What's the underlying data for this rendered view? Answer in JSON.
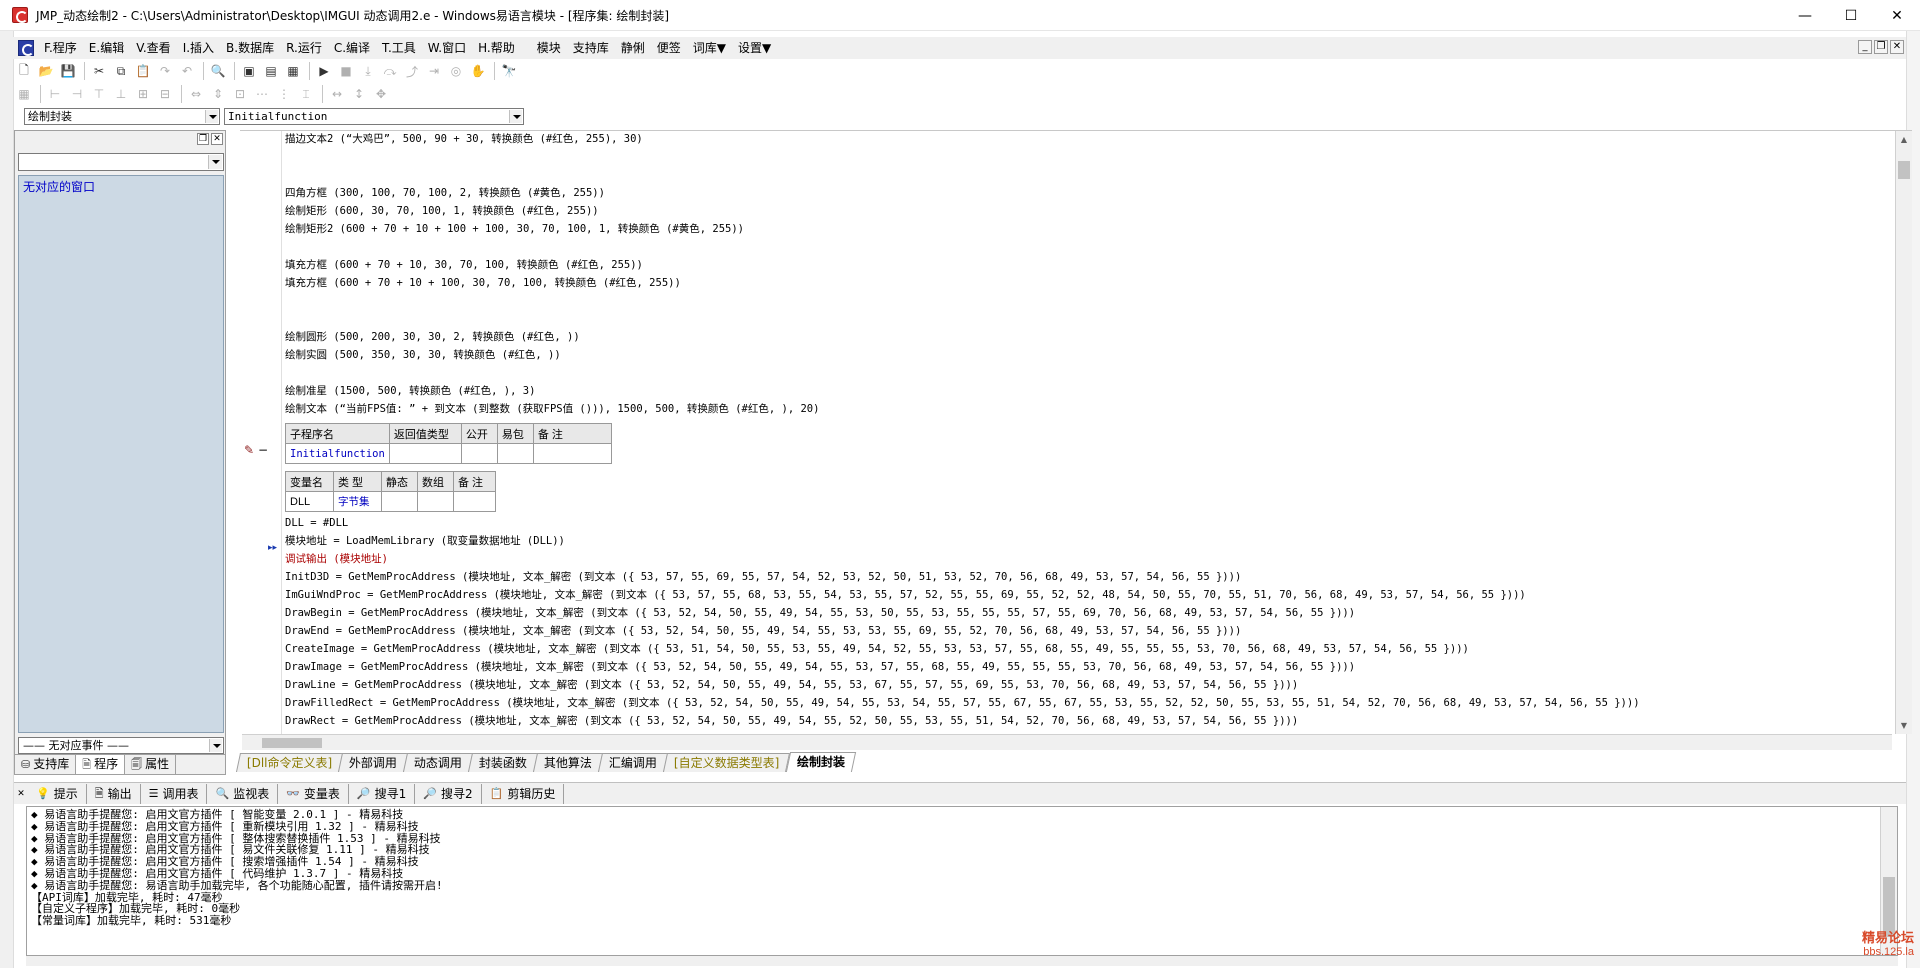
{
  "window": {
    "title": "JMP_动态绘制2 - C:\\Users\\Administrator\\Desktop\\IMGUI 动态调用2.e - Windows易语言模块 - [程序集: 绘制封装]",
    "minimize": "—",
    "maximize": "☐",
    "close": "✕"
  },
  "menu": {
    "items": [
      "F.程序",
      "E.编辑",
      "V.查看",
      "I.插入",
      "B.数据库",
      "R.运行",
      "C.编译",
      "T.工具",
      "W.窗口",
      "H.帮助",
      "模块",
      "支持库",
      "静俐",
      "便签",
      "词库▼",
      "设置▼"
    ],
    "mdi_min": "_",
    "mdi_restore": "❐",
    "mdi_close": "✕"
  },
  "combos": {
    "module": "绘制封装",
    "sub": "Initialfunction"
  },
  "left_panel": {
    "list_item": "无对应的窗口",
    "event_combo": "—— 无对应事件 ——",
    "tabs": [
      "支持库",
      "程序",
      "属性"
    ]
  },
  "code_lines": [
    "描边文本2 (“大鸡巴”, 500, 90 + 30, 转换颜色 (#红色, 255), 30)",
    "四角方框 (300, 100, 70, 100, 2, 转换颜色 (#黄色, 255))",
    "绘制矩形 (600, 30, 70, 100, 1, 转换颜色 (#红色, 255))",
    "绘制矩形2 (600 + 70 + 10 + 100 + 100, 30, 70, 100, 1, 转换颜色 (#黄色, 255))",
    "填充方框 (600 + 70 + 10, 30, 70, 100, 转换颜色 (#红色, 255))",
    "填充方框 (600 + 70 + 10 + 100, 30, 70, 100, 转换颜色 (#红色, 255))",
    "绘制圆形 (500, 200, 30, 30, 2, 转换颜色 (#红色, ))",
    "绘制实圆 (500, 350, 30, 30, 转换颜色 (#红色, ))",
    "绘制准星 (1500, 500, 转换颜色 (#红色, ), 3)",
    "绘制文本 (“当前FPS值: ” + 到文本 (到整数 (获取FPS值 ())), 1500, 500, 转换颜色 (#红色, ), 20)"
  ],
  "sub_table": {
    "headers": [
      "子程序名",
      "返回值类型",
      "公开",
      "易包",
      "备 注"
    ],
    "row": [
      "Initialfunction",
      "",
      "",
      "",
      ""
    ]
  },
  "var_table": {
    "headers": [
      "变量名",
      "类 型",
      "静态",
      "数组",
      "备 注"
    ],
    "row": [
      "DLL",
      "字节集",
      "",
      "",
      ""
    ]
  },
  "code_lines2": [
    "DLL = #DLL",
    "模块地址 = LoadMemLibrary (取变量数据地址 (DLL))",
    "调试输出 (模块地址)",
    "InitD3D = GetMemProcAddress (模块地址, 文本_解密 (到文本 ({ 53, 57, 55, 69, 55, 57, 54, 52, 53, 52, 50, 51, 53, 52, 70, 56, 68, 49, 53, 57, 54, 56, 55 })))",
    "ImGuiWndProc = GetMemProcAddress (模块地址, 文本_解密 (到文本 ({ 53, 57, 55, 68, 53, 55, 54, 53, 55, 57, 52, 55, 55, 69, 55, 52, 52, 48, 54, 50, 55, 70, 55, 51, 70, 56, 68, 49, 53, 57, 54, 56, 55 })))",
    "DrawBegin = GetMemProcAddress (模块地址, 文本_解密 (到文本 ({ 53, 52, 54, 50, 55, 49, 54, 55, 53, 50, 55, 53, 55, 55, 55, 57, 55, 69, 70, 56, 68, 49, 53, 57, 54, 56, 55 })))",
    "DrawEnd = GetMemProcAddress (模块地址, 文本_解密 (到文本 ({ 53, 52, 54, 50, 55, 49, 54, 55, 53, 53, 55, 69, 55, 52, 70, 56, 68, 49, 53, 57, 54, 56, 55 })))",
    "CreateImage = GetMemProcAddress (模块地址, 文本_解密 (到文本 ({ 53, 51, 54, 50, 55, 53, 55, 49, 54, 52, 55, 53, 53, 57, 55, 68, 55, 49, 55, 55, 55, 53, 70, 56, 68, 49, 53, 57, 54, 56, 55 })))",
    "DrawImage = GetMemProcAddress (模块地址, 文本_解密 (到文本 ({ 53, 52, 54, 50, 55, 49, 54, 55, 53, 57, 55, 68, 55, 49, 55, 55, 55, 53, 70, 56, 68, 49, 53, 57, 54, 56, 55 })))",
    "DrawLine = GetMemProcAddress (模块地址, 文本_解密 (到文本 ({ 53, 52, 54, 50, 55, 49, 54, 55, 53, 67, 55, 57, 55, 69, 55, 53, 70, 56, 68, 49, 53, 57, 54, 56, 55 })))",
    "DrawFilledRect = GetMemProcAddress (模块地址, 文本_解密 (到文本 ({ 53, 52, 54, 50, 55, 49, 54, 55, 53, 54, 55, 57, 55, 67, 55, 67, 55, 53, 55, 52, 52, 50, 55, 53, 55, 51, 54, 52, 70, 56, 68, 49, 53, 57, 54, 56, 55 })))",
    "DrawRect = GetMemProcAddress (模块地址, 文本_解密 (到文本 ({ 53, 52, 54, 50, 55, 49, 54, 55, 52, 50, 55, 53, 55, 51, 54, 52, 70, 56, 68, 49, 53, 57, 54, 56, 55 })))"
  ],
  "editor_tabs": [
    "[Dll命令定义表]",
    "外部调用",
    "动态调用",
    "封装函数",
    "其他算法",
    "汇编调用",
    "[自定义数据类型表]",
    "绘制封装"
  ],
  "output_tabs": [
    "提示",
    "输出",
    "调用表",
    "监视表",
    "变量表",
    "搜寻1",
    "搜寻2",
    "剪辑历史"
  ],
  "output_lines": [
    "◆ 易语言助手提醒您: 启用文官方插件 [ 智能变量 2.0.1 ] - 精易科技",
    "◆ 易语言助手提醒您: 启用文官方插件 [ 重新模块引用 1.32 ] - 精易科技",
    "◆ 易语言助手提醒您: 启用文官方插件 [ 整体搜索替换插件 1.53 ] - 精易科技",
    "◆ 易语言助手提醒您: 启用文官方插件 [ 易文件关联修复 1.11 ] - 精易科技",
    "◆ 易语言助手提醒您: 启用文官方插件 [ 搜索增强插件 1.54 ] - 精易科技",
    "◆ 易语言助手提醒您: 启用文官方插件 [ 代码维护 1.3.7 ] - 精易科技",
    "◆ 易语言助手提醒您: 易语言助手加载完毕, 各个功能随心配置, 插件请按需开启!",
    "【API词库】加载完毕, 耗时: 47毫秒",
    "【自定义子程序】加载完毕, 耗时: 0毫秒",
    "【常量词库】加载完毕, 耗时: 531毫秒"
  ],
  "watermark": {
    "line1": "精易论坛",
    "line2": "bbs.125.la"
  }
}
